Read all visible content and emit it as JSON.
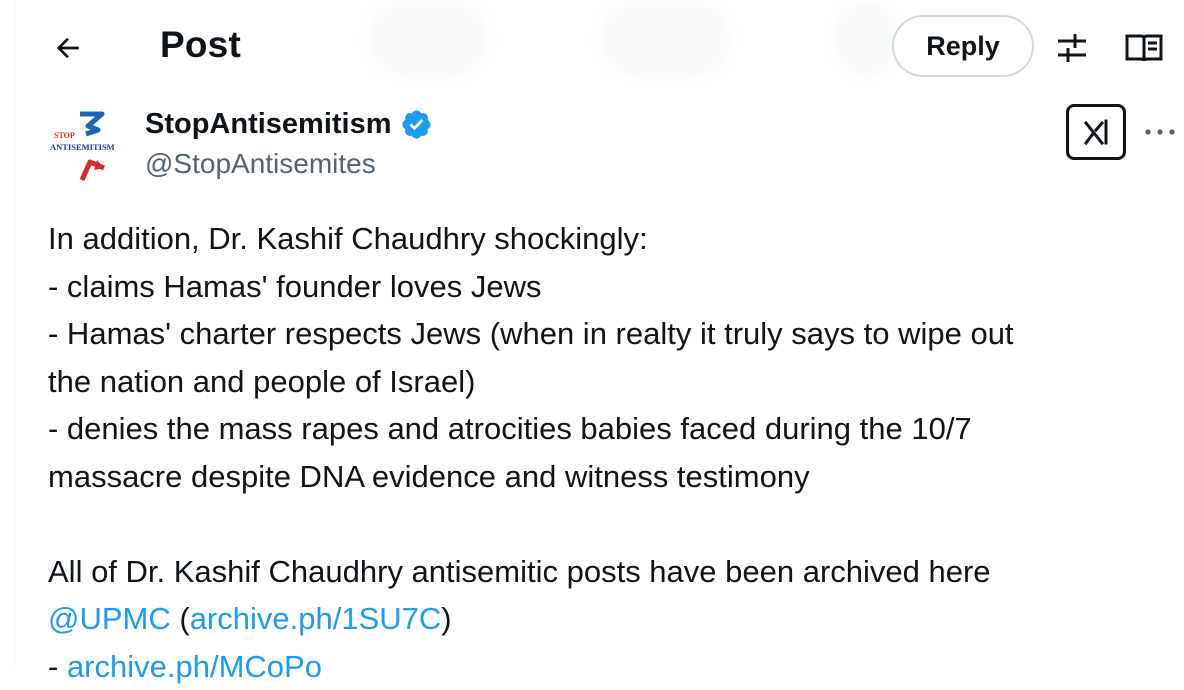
{
  "header": {
    "title": "Post",
    "reply_label": "Reply"
  },
  "author": {
    "display_name": "StopAntisemitism",
    "handle": "@StopAntisemites",
    "logo_text_top": "STOP",
    "logo_text_bottom": "ANTISEMITISM",
    "verified": true
  },
  "tweet": {
    "line1": "In addition, Dr. Kashif Chaudhry shockingly:",
    "line2": "- claims Hamas' founder loves Jews",
    "line3": "- Hamas' charter respects Jews (when in realty it truly says to wipe out",
    "line4": "the nation and people of Israel)",
    "line5": "- denies the mass rapes and atrocities babies faced during the 10/7",
    "line6": "massacre despite DNA evidence and witness testimony",
    "line7": "All of Dr. Kashif Chaudhry antisemitic posts have been archived here",
    "mention": "@UPMC",
    "open_paren": " (",
    "link1": "archive.ph/1SU7C",
    "close_paren": ")",
    "link2_partial": "archive.ph/MCoPo"
  },
  "colors": {
    "text": "#0f1419",
    "secondary": "#536471",
    "link": "#1d9bf0",
    "verified": "#1d9bf0",
    "border": "#cfd9de",
    "logo_blue": "#1e63b5",
    "logo_red": "#d62b2b"
  },
  "icons": {
    "back": "arrow-left-icon",
    "filters": "sliders-icon",
    "reader": "book-open-icon",
    "grok": "grok-icon",
    "more": "more-dots-icon",
    "verified": "verified-badge-icon"
  }
}
